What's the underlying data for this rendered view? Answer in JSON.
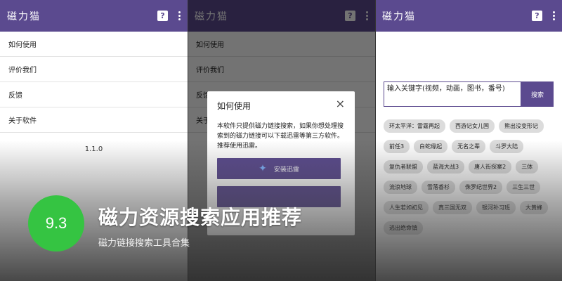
{
  "colors": {
    "appbar": "#5b4a8f",
    "score_badge": "#35c442"
  },
  "app_title": "磁力猫",
  "icons": {
    "help": "help-square-icon",
    "more": "more-vert-icon",
    "close": "close-icon",
    "bird": "xunlei-bird-icon"
  },
  "help_glyph": "?",
  "menu": {
    "items": [
      "如何使用",
      "评价我们",
      "反馈",
      "关于软件"
    ],
    "version": "1.1.0"
  },
  "dialog": {
    "title": "如何使用",
    "close": "×",
    "body": "本软件只提供磁力链接搜索，如果你想处理搜索到的磁力链接可以下载迅雷等第三方软件。推荐使用迅雷。",
    "install_button": "安装迅雷"
  },
  "search": {
    "placeholder": "输入关键字(视频，动画，图书，番号)",
    "button": "搜索"
  },
  "tags": [
    "环太平洋：雷霆再起",
    "西游记女儿国",
    "熊出没变形记",
    "前任3",
    "白蛇缘起",
    "无名之辈",
    "斗罗大陆",
    "复仇者联盟",
    "蓝海大战3",
    "唐人街探案2",
    "三体",
    "流浪地球",
    "雪落香杉",
    "侏罗纪世界2",
    "三生三世",
    "人生若如初见",
    "真三国无双",
    "银河补习班",
    "大黄蜂",
    "逃出绝命镇"
  ],
  "overlay": {
    "score": "9.3",
    "headline": "磁力资源搜索应用推荐",
    "subline": "磁力链接搜索工具合集"
  }
}
